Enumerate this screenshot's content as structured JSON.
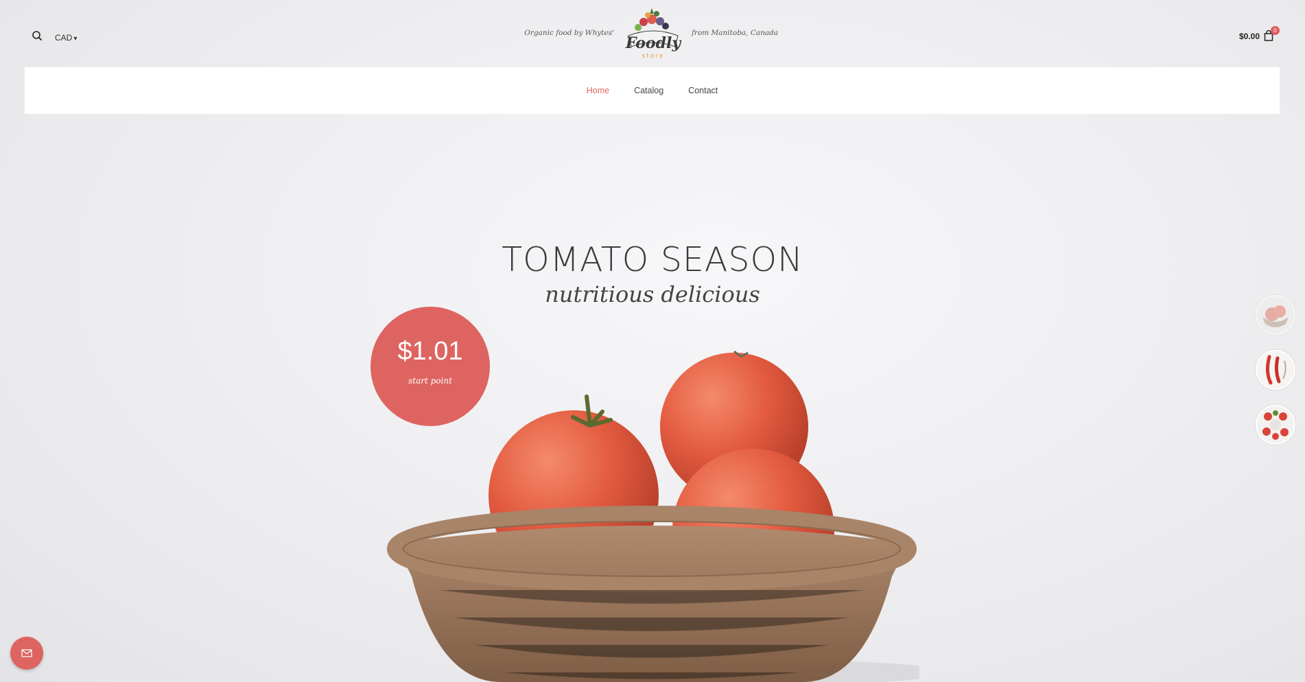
{
  "header": {
    "currency": "CAD",
    "tagline_left": "Organic food by Whytes'",
    "tagline_right": "from Manitoba, Canada",
    "logo_text": "Foodly",
    "logo_subtext": "store",
    "cart_total": "$0.00",
    "cart_count": "0"
  },
  "nav": {
    "items": [
      {
        "label": "Home",
        "active": true
      },
      {
        "label": "Catalog",
        "active": false
      },
      {
        "label": "Contact",
        "active": false
      }
    ]
  },
  "hero": {
    "title": "TOMATO SEASON",
    "subtitle": "nutritious delicious",
    "price": "$1.01",
    "price_label": "start point"
  },
  "colors": {
    "accent": "#de6461",
    "nav_active": "#e0675e"
  },
  "icons": [
    "search-icon",
    "cart-icon",
    "mail-icon",
    "chevron-down-icon"
  ]
}
